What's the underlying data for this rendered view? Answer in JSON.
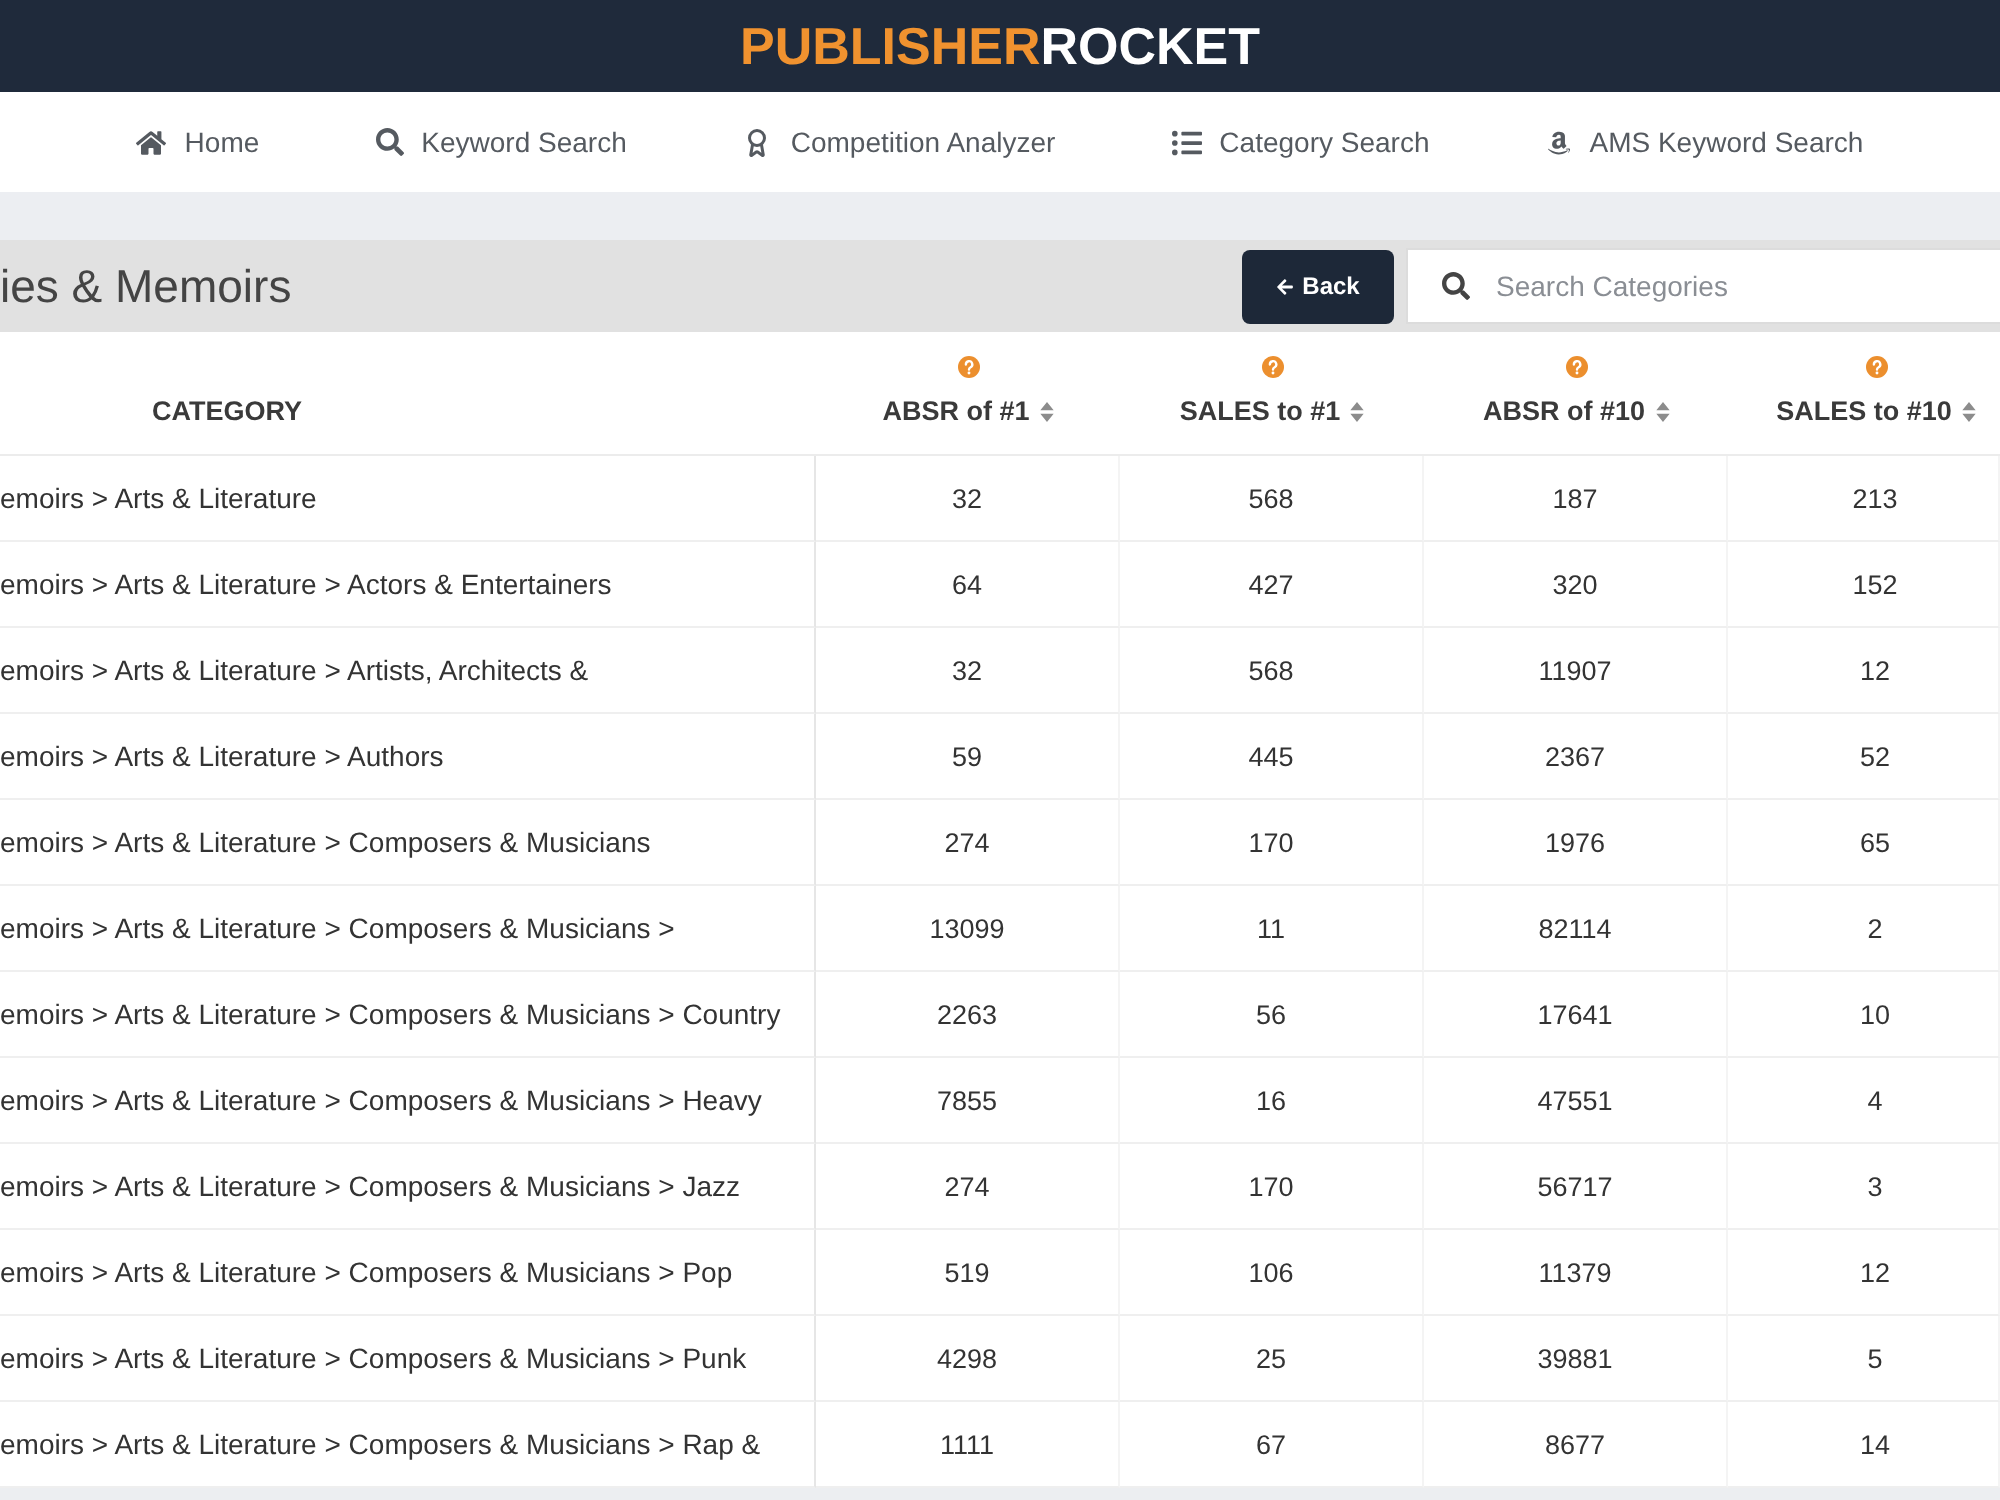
{
  "header": {
    "logo": [
      "PUBLISHER",
      "ROCKET"
    ]
  },
  "nav": {
    "items": [
      {
        "label": "Home"
      },
      {
        "label": "Keyword Search"
      },
      {
        "label": "Competition Analyzer"
      },
      {
        "label": "Category Search"
      },
      {
        "label": "AMS Keyword Search"
      }
    ]
  },
  "toolbar": {
    "title": "ies & Memoirs",
    "back_button": {
      "label": "Back"
    },
    "search": {
      "placeholder": "Search Categories"
    }
  },
  "table": {
    "columns": [
      {
        "label": "CATEGORY",
        "help": false,
        "sortable": false
      },
      {
        "label": "ABSR of #1",
        "help": true,
        "sortable": true
      },
      {
        "label": "SALES to #1",
        "help": true,
        "sortable": true
      },
      {
        "label": "ABSR of #10",
        "help": true,
        "sortable": true
      },
      {
        "label": "SALES to #10",
        "help": true,
        "sortable": true
      }
    ],
    "rows": [
      {
        "cells": [
          "emoirs > Arts & Literature",
          "32",
          "568",
          "187",
          "213"
        ]
      },
      {
        "cells": [
          "emoirs > Arts & Literature > Actors & Entertainers",
          "64",
          "427",
          "320",
          "152"
        ]
      },
      {
        "cells": [
          "emoirs > Arts & Literature > Artists, Architects &",
          "32",
          "568",
          "11907",
          "12"
        ]
      },
      {
        "cells": [
          "emoirs > Arts & Literature > Authors",
          "59",
          "445",
          "2367",
          "52"
        ]
      },
      {
        "cells": [
          "emoirs > Arts & Literature > Composers & Musicians",
          "274",
          "170",
          "1976",
          "65"
        ]
      },
      {
        "cells": [
          "emoirs > Arts & Literature > Composers & Musicians >",
          "13099",
          "11",
          "82114",
          "2"
        ]
      },
      {
        "cells": [
          "emoirs > Arts & Literature > Composers & Musicians > Country",
          "2263",
          "56",
          "17641",
          "10"
        ]
      },
      {
        "cells": [
          "emoirs > Arts & Literature > Composers & Musicians > Heavy",
          "7855",
          "16",
          "47551",
          "4"
        ]
      },
      {
        "cells": [
          "emoirs > Arts & Literature > Composers & Musicians > Jazz",
          "274",
          "170",
          "56717",
          "3"
        ]
      },
      {
        "cells": [
          "emoirs > Arts & Literature > Composers & Musicians > Pop",
          "519",
          "106",
          "11379",
          "12"
        ]
      },
      {
        "cells": [
          "emoirs > Arts & Literature > Composers & Musicians > Punk",
          "4298",
          "25",
          "39881",
          "5"
        ]
      },
      {
        "cells": [
          "emoirs > Arts & Literature > Composers & Musicians > Rap &",
          "1111",
          "67",
          "8677",
          "14"
        ]
      }
    ]
  }
}
